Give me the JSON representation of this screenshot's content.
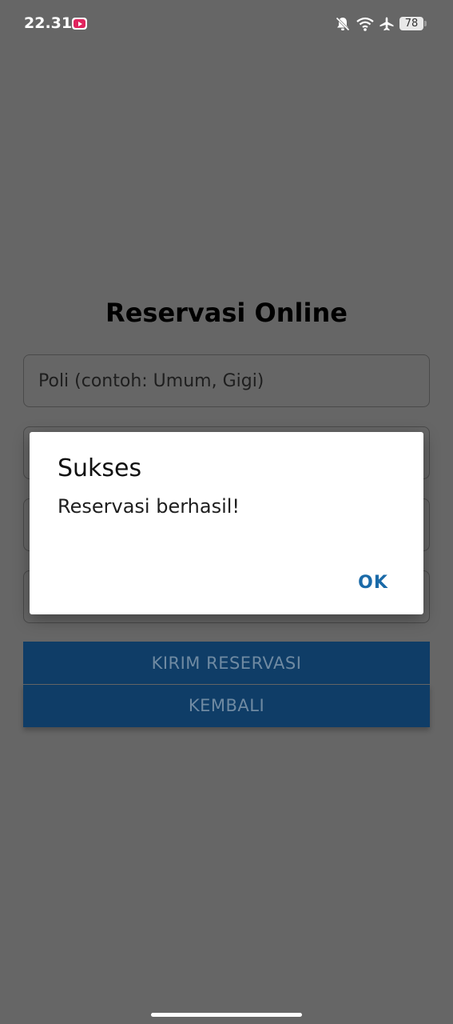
{
  "status_bar": {
    "time": "22.31",
    "battery_level": "78",
    "icons": [
      "youtube-notification-icon",
      "bell-off-icon",
      "wifi-icon",
      "airplane-mode-icon",
      "battery-icon"
    ]
  },
  "form": {
    "title": "Reservasi Online",
    "fields": [
      {
        "placeholder": "Poli (contoh: Umum, Gigi)"
      }
    ],
    "submit_label": "KIRIM RESERVASI",
    "back_label": "KEMBALI"
  },
  "dialog": {
    "title": "Sukses",
    "message": "Reservasi berhasil!",
    "ok_label": "OK"
  },
  "colors": {
    "scrim": "#666666",
    "button": "#0f3d67",
    "dialog_accent": "#1a6aa8"
  }
}
